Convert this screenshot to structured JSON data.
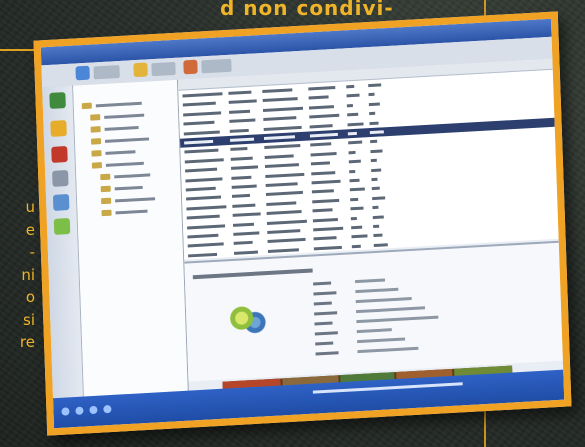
{
  "article": {
    "heading_fragment": "d non condivi-",
    "body_fragments": [
      "u",
      "e",
      "-",
      "ni",
      "o",
      "si",
      "re"
    ]
  },
  "colors": {
    "accent": "#f0b428",
    "frame": "#f0a224",
    "background": "#2a302b",
    "app_titlebar": "#2b54a8",
    "app_selection": "#2c3f6e"
  },
  "icons": {
    "app_logo": "swirl-logo-icon"
  }
}
